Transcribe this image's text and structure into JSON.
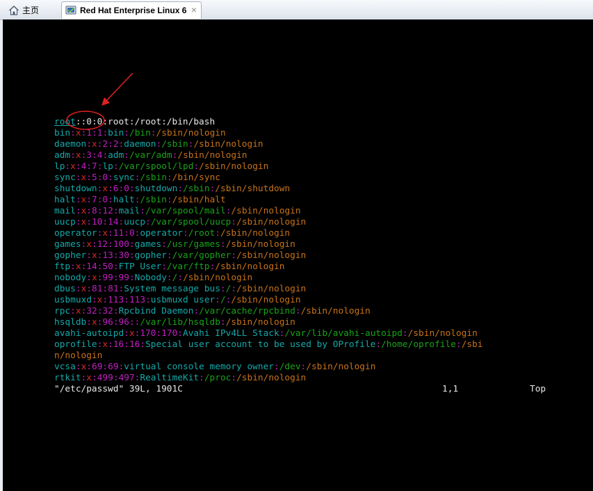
{
  "tabs": {
    "home_label": "主页",
    "vm_label": "Red Hat Enterprise Linux 6",
    "close_glyph": "×",
    "icons": {
      "home": "home-icon",
      "vm": "vm-icon",
      "close": "close-icon"
    }
  },
  "colors": {
    "background": "#000000",
    "field": "#16a9a9",
    "password_x": "#d82a2a",
    "ids_and_separators": "#c31ec3",
    "directory": "#1aa21a",
    "shell": "#c8731a",
    "annotation": "#e02020"
  },
  "terminal": {
    "lines": [
      [
        {
          "t": "root",
          "c": "t",
          "u": true
        },
        {
          "t": "::0:0:root:/root:/bin/bash",
          "c": "w"
        }
      ],
      [
        {
          "t": "bin",
          "c": "t"
        },
        {
          "t": ":",
          "c": "m"
        },
        {
          "t": "x",
          "c": "r"
        },
        {
          "t": ":",
          "c": "m"
        },
        {
          "t": "1",
          "c": "m"
        },
        {
          "t": ":",
          "c": "m"
        },
        {
          "t": "1",
          "c": "m"
        },
        {
          "t": ":",
          "c": "m"
        },
        {
          "t": "bin",
          "c": "t"
        },
        {
          "t": ":",
          "c": "m"
        },
        {
          "t": "/bin",
          "c": "g"
        },
        {
          "t": ":",
          "c": "m"
        },
        {
          "t": "/sbin/nologin",
          "c": "o"
        }
      ],
      [
        {
          "t": "daemon",
          "c": "t"
        },
        {
          "t": ":",
          "c": "m"
        },
        {
          "t": "x",
          "c": "r"
        },
        {
          "t": ":",
          "c": "m"
        },
        {
          "t": "2",
          "c": "m"
        },
        {
          "t": ":",
          "c": "m"
        },
        {
          "t": "2",
          "c": "m"
        },
        {
          "t": ":",
          "c": "m"
        },
        {
          "t": "daemon",
          "c": "t"
        },
        {
          "t": ":",
          "c": "m"
        },
        {
          "t": "/sbin",
          "c": "g"
        },
        {
          "t": ":",
          "c": "m"
        },
        {
          "t": "/sbin/nologin",
          "c": "o"
        }
      ],
      [
        {
          "t": "adm",
          "c": "t"
        },
        {
          "t": ":",
          "c": "m"
        },
        {
          "t": "x",
          "c": "r"
        },
        {
          "t": ":",
          "c": "m"
        },
        {
          "t": "3",
          "c": "m"
        },
        {
          "t": ":",
          "c": "m"
        },
        {
          "t": "4",
          "c": "m"
        },
        {
          "t": ":",
          "c": "m"
        },
        {
          "t": "adm",
          "c": "t"
        },
        {
          "t": ":",
          "c": "m"
        },
        {
          "t": "/var/adm",
          "c": "g"
        },
        {
          "t": ":",
          "c": "m"
        },
        {
          "t": "/sbin/nologin",
          "c": "o"
        }
      ],
      [
        {
          "t": "lp",
          "c": "t"
        },
        {
          "t": ":",
          "c": "m"
        },
        {
          "t": "x",
          "c": "r"
        },
        {
          "t": ":",
          "c": "m"
        },
        {
          "t": "4",
          "c": "m"
        },
        {
          "t": ":",
          "c": "m"
        },
        {
          "t": "7",
          "c": "m"
        },
        {
          "t": ":",
          "c": "m"
        },
        {
          "t": "lp",
          "c": "t"
        },
        {
          "t": ":",
          "c": "m"
        },
        {
          "t": "/var/spool/lpd",
          "c": "g"
        },
        {
          "t": ":",
          "c": "m"
        },
        {
          "t": "/sbin/nologin",
          "c": "o"
        }
      ],
      [
        {
          "t": "sync",
          "c": "t"
        },
        {
          "t": ":",
          "c": "m"
        },
        {
          "t": "x",
          "c": "r"
        },
        {
          "t": ":",
          "c": "m"
        },
        {
          "t": "5",
          "c": "m"
        },
        {
          "t": ":",
          "c": "m"
        },
        {
          "t": "0",
          "c": "m"
        },
        {
          "t": ":",
          "c": "m"
        },
        {
          "t": "sync",
          "c": "t"
        },
        {
          "t": ":",
          "c": "m"
        },
        {
          "t": "/sbin",
          "c": "g"
        },
        {
          "t": ":",
          "c": "m"
        },
        {
          "t": "/bin/sync",
          "c": "o"
        }
      ],
      [
        {
          "t": "shutdown",
          "c": "t"
        },
        {
          "t": ":",
          "c": "m"
        },
        {
          "t": "x",
          "c": "r"
        },
        {
          "t": ":",
          "c": "m"
        },
        {
          "t": "6",
          "c": "m"
        },
        {
          "t": ":",
          "c": "m"
        },
        {
          "t": "0",
          "c": "m"
        },
        {
          "t": ":",
          "c": "m"
        },
        {
          "t": "shutdown",
          "c": "t"
        },
        {
          "t": ":",
          "c": "m"
        },
        {
          "t": "/sbin",
          "c": "g"
        },
        {
          "t": ":",
          "c": "m"
        },
        {
          "t": "/sbin/shutdown",
          "c": "o"
        }
      ],
      [
        {
          "t": "halt",
          "c": "t"
        },
        {
          "t": ":",
          "c": "m"
        },
        {
          "t": "x",
          "c": "r"
        },
        {
          "t": ":",
          "c": "m"
        },
        {
          "t": "7",
          "c": "m"
        },
        {
          "t": ":",
          "c": "m"
        },
        {
          "t": "0",
          "c": "m"
        },
        {
          "t": ":",
          "c": "m"
        },
        {
          "t": "halt",
          "c": "t"
        },
        {
          "t": ":",
          "c": "m"
        },
        {
          "t": "/sbin",
          "c": "g"
        },
        {
          "t": ":",
          "c": "m"
        },
        {
          "t": "/sbin/halt",
          "c": "o"
        }
      ],
      [
        {
          "t": "mail",
          "c": "t"
        },
        {
          "t": ":",
          "c": "m"
        },
        {
          "t": "x",
          "c": "r"
        },
        {
          "t": ":",
          "c": "m"
        },
        {
          "t": "8",
          "c": "m"
        },
        {
          "t": ":",
          "c": "m"
        },
        {
          "t": "12",
          "c": "m"
        },
        {
          "t": ":",
          "c": "m"
        },
        {
          "t": "mail",
          "c": "t"
        },
        {
          "t": ":",
          "c": "m"
        },
        {
          "t": "/var/spool/mail",
          "c": "g"
        },
        {
          "t": ":",
          "c": "m"
        },
        {
          "t": "/sbin/nologin",
          "c": "o"
        }
      ],
      [
        {
          "t": "uucp",
          "c": "t"
        },
        {
          "t": ":",
          "c": "m"
        },
        {
          "t": "x",
          "c": "r"
        },
        {
          "t": ":",
          "c": "m"
        },
        {
          "t": "10",
          "c": "m"
        },
        {
          "t": ":",
          "c": "m"
        },
        {
          "t": "14",
          "c": "m"
        },
        {
          "t": ":",
          "c": "m"
        },
        {
          "t": "uucp",
          "c": "t"
        },
        {
          "t": ":",
          "c": "m"
        },
        {
          "t": "/var/spool/uucp",
          "c": "g"
        },
        {
          "t": ":",
          "c": "m"
        },
        {
          "t": "/sbin/nologin",
          "c": "o"
        }
      ],
      [
        {
          "t": "operator",
          "c": "t"
        },
        {
          "t": ":",
          "c": "m"
        },
        {
          "t": "x",
          "c": "r"
        },
        {
          "t": ":",
          "c": "m"
        },
        {
          "t": "11",
          "c": "m"
        },
        {
          "t": ":",
          "c": "m"
        },
        {
          "t": "0",
          "c": "m"
        },
        {
          "t": ":",
          "c": "m"
        },
        {
          "t": "operator",
          "c": "t"
        },
        {
          "t": ":",
          "c": "m"
        },
        {
          "t": "/root",
          "c": "g"
        },
        {
          "t": ":",
          "c": "m"
        },
        {
          "t": "/sbin/nologin",
          "c": "o"
        }
      ],
      [
        {
          "t": "games",
          "c": "t"
        },
        {
          "t": ":",
          "c": "m"
        },
        {
          "t": "x",
          "c": "r"
        },
        {
          "t": ":",
          "c": "m"
        },
        {
          "t": "12",
          "c": "m"
        },
        {
          "t": ":",
          "c": "m"
        },
        {
          "t": "100",
          "c": "m"
        },
        {
          "t": ":",
          "c": "m"
        },
        {
          "t": "games",
          "c": "t"
        },
        {
          "t": ":",
          "c": "m"
        },
        {
          "t": "/usr/games",
          "c": "g"
        },
        {
          "t": ":",
          "c": "m"
        },
        {
          "t": "/sbin/nologin",
          "c": "o"
        }
      ],
      [
        {
          "t": "gopher",
          "c": "t"
        },
        {
          "t": ":",
          "c": "m"
        },
        {
          "t": "x",
          "c": "r"
        },
        {
          "t": ":",
          "c": "m"
        },
        {
          "t": "13",
          "c": "m"
        },
        {
          "t": ":",
          "c": "m"
        },
        {
          "t": "30",
          "c": "m"
        },
        {
          "t": ":",
          "c": "m"
        },
        {
          "t": "gopher",
          "c": "t"
        },
        {
          "t": ":",
          "c": "m"
        },
        {
          "t": "/var/gopher",
          "c": "g"
        },
        {
          "t": ":",
          "c": "m"
        },
        {
          "t": "/sbin/nologin",
          "c": "o"
        }
      ],
      [
        {
          "t": "ftp",
          "c": "t"
        },
        {
          "t": ":",
          "c": "m"
        },
        {
          "t": "x",
          "c": "r"
        },
        {
          "t": ":",
          "c": "m"
        },
        {
          "t": "14",
          "c": "m"
        },
        {
          "t": ":",
          "c": "m"
        },
        {
          "t": "50",
          "c": "m"
        },
        {
          "t": ":",
          "c": "m"
        },
        {
          "t": "FTP User",
          "c": "t"
        },
        {
          "t": ":",
          "c": "m"
        },
        {
          "t": "/var/ftp",
          "c": "g"
        },
        {
          "t": ":",
          "c": "m"
        },
        {
          "t": "/sbin/nologin",
          "c": "o"
        }
      ],
      [
        {
          "t": "nobody",
          "c": "t"
        },
        {
          "t": ":",
          "c": "m"
        },
        {
          "t": "x",
          "c": "r"
        },
        {
          "t": ":",
          "c": "m"
        },
        {
          "t": "99",
          "c": "m"
        },
        {
          "t": ":",
          "c": "m"
        },
        {
          "t": "99",
          "c": "m"
        },
        {
          "t": ":",
          "c": "m"
        },
        {
          "t": "Nobody",
          "c": "t"
        },
        {
          "t": ":",
          "c": "m"
        },
        {
          "t": "/",
          "c": "g"
        },
        {
          "t": ":",
          "c": "m"
        },
        {
          "t": "/sbin/nologin",
          "c": "o"
        }
      ],
      [
        {
          "t": "dbus",
          "c": "t"
        },
        {
          "t": ":",
          "c": "m"
        },
        {
          "t": "x",
          "c": "r"
        },
        {
          "t": ":",
          "c": "m"
        },
        {
          "t": "81",
          "c": "m"
        },
        {
          "t": ":",
          "c": "m"
        },
        {
          "t": "81",
          "c": "m"
        },
        {
          "t": ":",
          "c": "m"
        },
        {
          "t": "System message bus",
          "c": "t"
        },
        {
          "t": ":",
          "c": "m"
        },
        {
          "t": "/",
          "c": "g"
        },
        {
          "t": ":",
          "c": "m"
        },
        {
          "t": "/sbin/nologin",
          "c": "o"
        }
      ],
      [
        {
          "t": "usbmuxd",
          "c": "t"
        },
        {
          "t": ":",
          "c": "m"
        },
        {
          "t": "x",
          "c": "r"
        },
        {
          "t": ":",
          "c": "m"
        },
        {
          "t": "113",
          "c": "m"
        },
        {
          "t": ":",
          "c": "m"
        },
        {
          "t": "113",
          "c": "m"
        },
        {
          "t": ":",
          "c": "m"
        },
        {
          "t": "usbmuxd user",
          "c": "t"
        },
        {
          "t": ":",
          "c": "m"
        },
        {
          "t": "/",
          "c": "g"
        },
        {
          "t": ":",
          "c": "m"
        },
        {
          "t": "/sbin/nologin",
          "c": "o"
        }
      ],
      [
        {
          "t": "rpc",
          "c": "t"
        },
        {
          "t": ":",
          "c": "m"
        },
        {
          "t": "x",
          "c": "r"
        },
        {
          "t": ":",
          "c": "m"
        },
        {
          "t": "32",
          "c": "m"
        },
        {
          "t": ":",
          "c": "m"
        },
        {
          "t": "32",
          "c": "m"
        },
        {
          "t": ":",
          "c": "m"
        },
        {
          "t": "Rpcbind Daemon",
          "c": "t"
        },
        {
          "t": ":",
          "c": "m"
        },
        {
          "t": "/var/cache/rpcbind",
          "c": "g"
        },
        {
          "t": ":",
          "c": "m"
        },
        {
          "t": "/sbin/nologin",
          "c": "o"
        }
      ],
      [
        {
          "t": "hsqldb",
          "c": "t"
        },
        {
          "t": ":",
          "c": "m"
        },
        {
          "t": "x",
          "c": "r"
        },
        {
          "t": ":",
          "c": "m"
        },
        {
          "t": "96",
          "c": "m"
        },
        {
          "t": ":",
          "c": "m"
        },
        {
          "t": "96",
          "c": "m"
        },
        {
          "t": ":",
          "c": "m"
        },
        {
          "t": ":",
          "c": "m"
        },
        {
          "t": "/var/lib/hsqldb",
          "c": "g"
        },
        {
          "t": ":",
          "c": "m"
        },
        {
          "t": "/sbin/nologin",
          "c": "o"
        }
      ],
      [
        {
          "t": "avahi-autoipd",
          "c": "t"
        },
        {
          "t": ":",
          "c": "m"
        },
        {
          "t": "x",
          "c": "r"
        },
        {
          "t": ":",
          "c": "m"
        },
        {
          "t": "170",
          "c": "m"
        },
        {
          "t": ":",
          "c": "m"
        },
        {
          "t": "170",
          "c": "m"
        },
        {
          "t": ":",
          "c": "m"
        },
        {
          "t": "Avahi IPv4LL Stack",
          "c": "t"
        },
        {
          "t": ":",
          "c": "m"
        },
        {
          "t": "/var/lib/avahi-autoipd",
          "c": "g"
        },
        {
          "t": ":",
          "c": "m"
        },
        {
          "t": "/sbin/nologin",
          "c": "o"
        }
      ],
      [
        {
          "t": "oprofile",
          "c": "t"
        },
        {
          "t": ":",
          "c": "m"
        },
        {
          "t": "x",
          "c": "r"
        },
        {
          "t": ":",
          "c": "m"
        },
        {
          "t": "16",
          "c": "m"
        },
        {
          "t": ":",
          "c": "m"
        },
        {
          "t": "16",
          "c": "m"
        },
        {
          "t": ":",
          "c": "m"
        },
        {
          "t": "Special user account to be used by OProfile",
          "c": "t"
        },
        {
          "t": ":",
          "c": "m"
        },
        {
          "t": "/home/oprofile",
          "c": "g"
        },
        {
          "t": ":",
          "c": "m"
        },
        {
          "t": "/sbi",
          "c": "o"
        }
      ],
      [
        {
          "t": "n/nologin",
          "c": "o"
        }
      ],
      [
        {
          "t": "vcsa",
          "c": "t"
        },
        {
          "t": ":",
          "c": "m"
        },
        {
          "t": "x",
          "c": "r"
        },
        {
          "t": ":",
          "c": "m"
        },
        {
          "t": "69",
          "c": "m"
        },
        {
          "t": ":",
          "c": "m"
        },
        {
          "t": "69",
          "c": "m"
        },
        {
          "t": ":",
          "c": "m"
        },
        {
          "t": "virtual console memory owner",
          "c": "t"
        },
        {
          "t": ":",
          "c": "m"
        },
        {
          "t": "/dev",
          "c": "g"
        },
        {
          "t": ":",
          "c": "m"
        },
        {
          "t": "/sbin/nologin",
          "c": "o"
        }
      ],
      [
        {
          "t": "rtkit",
          "c": "t"
        },
        {
          "t": ":",
          "c": "m"
        },
        {
          "t": "x",
          "c": "r"
        },
        {
          "t": ":",
          "c": "m"
        },
        {
          "t": "499",
          "c": "m"
        },
        {
          "t": ":",
          "c": "m"
        },
        {
          "t": "497",
          "c": "m"
        },
        {
          "t": ":",
          "c": "m"
        },
        {
          "t": "RealtimeKit",
          "c": "t"
        },
        {
          "t": ":",
          "c": "m"
        },
        {
          "t": "/proc",
          "c": "g"
        },
        {
          "t": ":",
          "c": "m"
        },
        {
          "t": "/sbin/nologin",
          "c": "o"
        }
      ]
    ],
    "status": {
      "file_info": "\"/etc/passwd\" 39L, 1901C",
      "cursor_pos": "1,1",
      "scroll_pos": "Top"
    }
  }
}
